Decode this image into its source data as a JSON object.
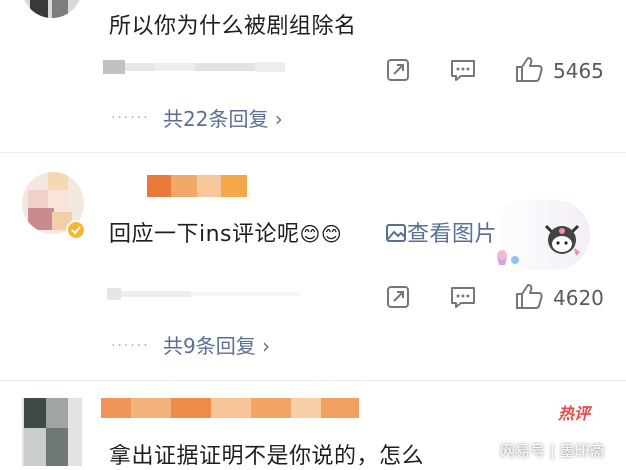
{
  "comments": [
    {
      "text": "所以你为什么被剧组除名",
      "like_count": "5465",
      "reply_link": "共22条回复 ›"
    },
    {
      "text": "回应一下ins评论呢",
      "emojis": "😊😊",
      "view_image_label": "查看图片",
      "like_count": "4620",
      "reply_link": "共9条回复 ›"
    },
    {
      "hot_badge": "热评",
      "text": "拿出证据证明不是你说的，怎么"
    }
  ],
  "reply_dots": "......",
  "watermark": "网易号 | 墨印斋",
  "icons": {
    "forward": "forward-icon",
    "comment": "comment-icon",
    "like": "thumbs-up-icon",
    "image": "image-icon",
    "verified": "verified-badge-icon"
  }
}
